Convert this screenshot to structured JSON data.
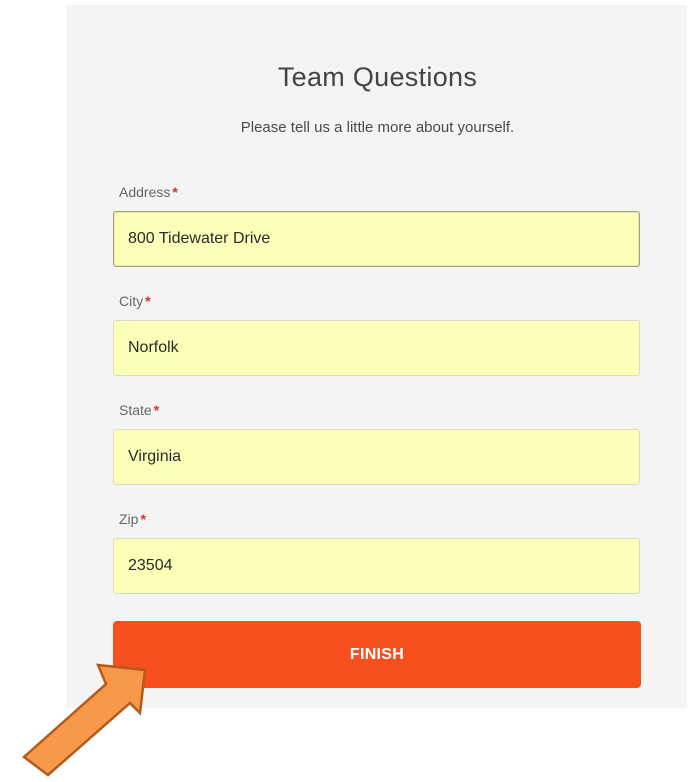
{
  "form": {
    "title": "Team Questions",
    "subtitle": "Please tell us a little more about yourself.",
    "required_marker": "*",
    "fields": [
      {
        "label": "Address",
        "value": "800 Tidewater Drive"
      },
      {
        "label": "City",
        "value": "Norfolk"
      },
      {
        "label": "State",
        "value": "Virginia"
      },
      {
        "label": "Zip",
        "value": "23504"
      }
    ],
    "finish_label": "FINISH"
  },
  "colors": {
    "panel_background": "#f4f4f4",
    "input_background": "#fbffb8",
    "button": "#f84f1f",
    "required": "#d9302a",
    "arrow": "#f7994a"
  },
  "icons": {
    "annotation": "arrow-icon"
  }
}
